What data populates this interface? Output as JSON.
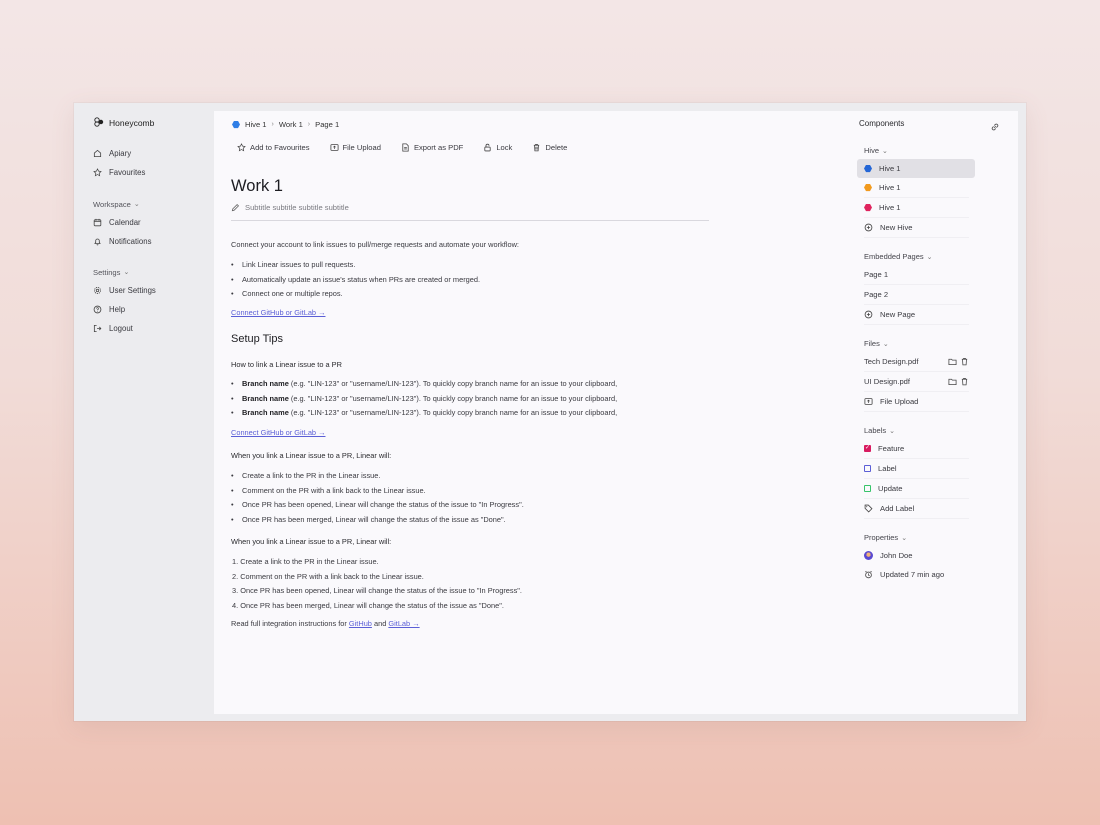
{
  "brand": {
    "name": "Honeycomb"
  },
  "sidebar": {
    "top_items": [
      {
        "label": "Apiary",
        "icon": "home-icon"
      },
      {
        "label": "Favourites",
        "icon": "star-icon"
      }
    ],
    "workspace": {
      "title": "Workspace",
      "items": [
        {
          "label": "Calendar",
          "icon": "calendar-icon"
        },
        {
          "label": "Notifications",
          "icon": "bell-icon"
        }
      ]
    },
    "settings": {
      "title": "Settings",
      "items": [
        {
          "label": "User Settings",
          "icon": "gear-icon"
        },
        {
          "label": "Help",
          "icon": "help-icon"
        },
        {
          "label": "Logout",
          "icon": "logout-icon"
        }
      ]
    }
  },
  "breadcrumb": {
    "items": [
      "Hive 1",
      "Work 1",
      "Page 1"
    ],
    "separator": "›",
    "hive_color": "#2f7ee6"
  },
  "toolbar": {
    "favourites": "Add to Favourites",
    "upload": "File Upload",
    "export": "Export as PDF",
    "lock": "Lock",
    "delete": "Delete"
  },
  "page": {
    "title": "Work 1",
    "subtitle": "Subtitle subtitle subtitle subtitle",
    "intro": "Connect your account to link issues to pull/merge requests and automate your workflow:",
    "intro_list": [
      "Link Linear issues to pull requests.",
      "Automatically update an issue's status when PRs are created or merged.",
      "Connect one or multiple repos."
    ],
    "connect_link": "Connect GitHub or GitLab →",
    "setup_heading": "Setup Tips",
    "howto_heading": "How to link a Linear issue to a PR",
    "branch_items": [
      {
        "bold": "Branch name",
        "text": " (e.g. \"LIN-123\" or \"username/LIN-123\"). To quickly copy branch name for an issue to your clipboard,"
      },
      {
        "bold": "Branch name",
        "text": " (e.g. \"LIN-123\" or \"username/LIN-123\"). To quickly copy branch name for an issue to your clipboard,"
      },
      {
        "bold": "Branch name",
        "text": " (e.g. \"LIN-123\" or \"username/LIN-123\"). To quickly copy branch name for an issue to your clipboard,"
      }
    ],
    "connect_link_2": "Connect GitHub or GitLab →",
    "when_heading_1": "When you link a Linear issue to a PR, Linear will:",
    "when_list_1": [
      "Create a link to the PR in the Linear issue.",
      "Comment on the PR with a link back to the Linear issue.",
      "Once PR has been opened, Linear will change the status of the issue to \"In Progress\".",
      "Once PR has been merged, Linear will change the status of the issue as \"Done\"."
    ],
    "when_heading_2": "When you link a Linear issue to a PR, Linear will:",
    "when_list_2": [
      "1. Create a link to the PR in the Linear issue.",
      "2. Comment on the PR with a link back to the Linear issue.",
      "3. Once PR has been opened, Linear will change the status of the issue to \"In Progress\".",
      "4. Once PR has been merged, Linear will change the status of the issue as \"Done\"."
    ],
    "footer_prefix": "Read full integration instructions for ",
    "footer_github": "GitHub",
    "footer_and": " and ",
    "footer_gitlab": "GitLab →"
  },
  "components": {
    "title": "Components",
    "hive": {
      "title": "Hive",
      "items": [
        {
          "label": "Hive 1",
          "color": "#2466d6"
        },
        {
          "label": "Hive 1",
          "color": "#f29a1e"
        },
        {
          "label": "Hive 1",
          "color": "#e0245e"
        }
      ],
      "new_label": "New Hive"
    },
    "embedded": {
      "title": "Embedded Pages",
      "items": [
        "Page 1",
        "Page 2"
      ],
      "new_label": "New Page"
    },
    "files": {
      "title": "Files",
      "items": [
        "Tech Design.pdf",
        "UI Design.pdf"
      ],
      "upload_label": "File Upload"
    },
    "labels": {
      "title": "Labels",
      "items": [
        {
          "label": "Feature",
          "color": "#d81b60",
          "checked": true
        },
        {
          "label": "Label",
          "color": "#5b5fd6",
          "checked": false
        },
        {
          "label": "Update",
          "color": "#37c46a",
          "checked": false
        }
      ],
      "add_label": "Add Label"
    },
    "properties": {
      "title": "Properties",
      "owner": "John Doe",
      "updated": "Updated 7 min ago"
    }
  }
}
